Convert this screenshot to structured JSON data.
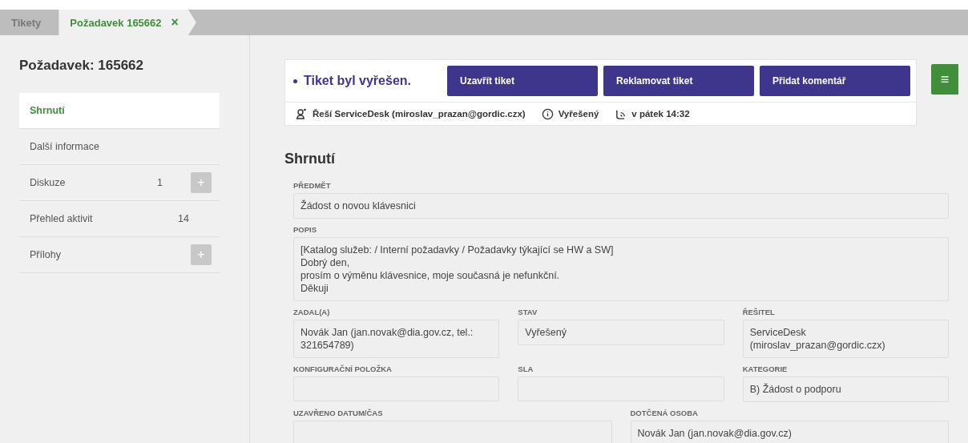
{
  "breadcrumbs": [
    {
      "label": "Tikety",
      "selected": false
    },
    {
      "label": "Požadavek 165662",
      "selected": true,
      "close_glyph": "×"
    }
  ],
  "sidebar": {
    "title": "Požadavek: 165662",
    "items": [
      {
        "label": "Shrnutí",
        "selected": true
      },
      {
        "label": "Další informace",
        "selected": false
      },
      {
        "label": "Diskuze",
        "selected": false,
        "count": "1",
        "add_button": "+"
      },
      {
        "label": "Přehled aktivit",
        "selected": false,
        "count": "14"
      },
      {
        "label": "Přílohy",
        "selected": false,
        "add_button": "+"
      }
    ]
  },
  "status_card": {
    "status": "Tiket byl vyřešen.",
    "buttons": [
      "Uzavřít tiket",
      "Reklamovat tiket",
      "Přidat komentář"
    ],
    "info": [
      {
        "kind": "person",
        "text": "Řeší ServiceDesk (miroslav_prazan@gordic.czx)"
      },
      {
        "kind": "info",
        "text": "Vyřešený"
      },
      {
        "kind": "time",
        "text": "v pátek 14:32"
      }
    ]
  },
  "menu_button": "≡",
  "section_title": "Shrnutí",
  "field_rows": [
    [
      {
        "label": "PŘEDMĚT",
        "lines": [
          "Žádost o novou klávesnici"
        ]
      }
    ],
    [
      {
        "label": "POPIS",
        "lines": [
          "[Katalog služeb:  / Interní požadavky / Požadavky týkající se HW a SW]",
          "Dobrý den,",
          "prosím o výměnu klávesnice, moje současná je nefunkční.",
          "Děkuji"
        ]
      }
    ],
    [
      {
        "label": "ZADAL(A)",
        "lines": [
          "Novák Jan (jan.novak@dia.gov.cz, tel.: 321654789)"
        ]
      },
      {
        "label": "STAV",
        "lines": [
          "Vyřešený"
        ]
      },
      {
        "label": "ŘEŠITEL",
        "lines": [
          "ServiceDesk (miroslav_prazan@gordic.czx)"
        ]
      }
    ],
    [
      {
        "label": "KONFIGURAČNÍ POLOŽKA"
      },
      {
        "label": "SLA"
      },
      {
        "label": "KATEGORIE",
        "lines": [
          "B) Žádost o podporu"
        ]
      }
    ],
    [
      {
        "label": "UZAVŘENO DATUM/ČAS"
      },
      {
        "label": "DOTČENÁ OSOBA",
        "lines": [
          "Novák Jan (jan.novak@dia.gov.cz)"
        ]
      }
    ]
  ]
}
